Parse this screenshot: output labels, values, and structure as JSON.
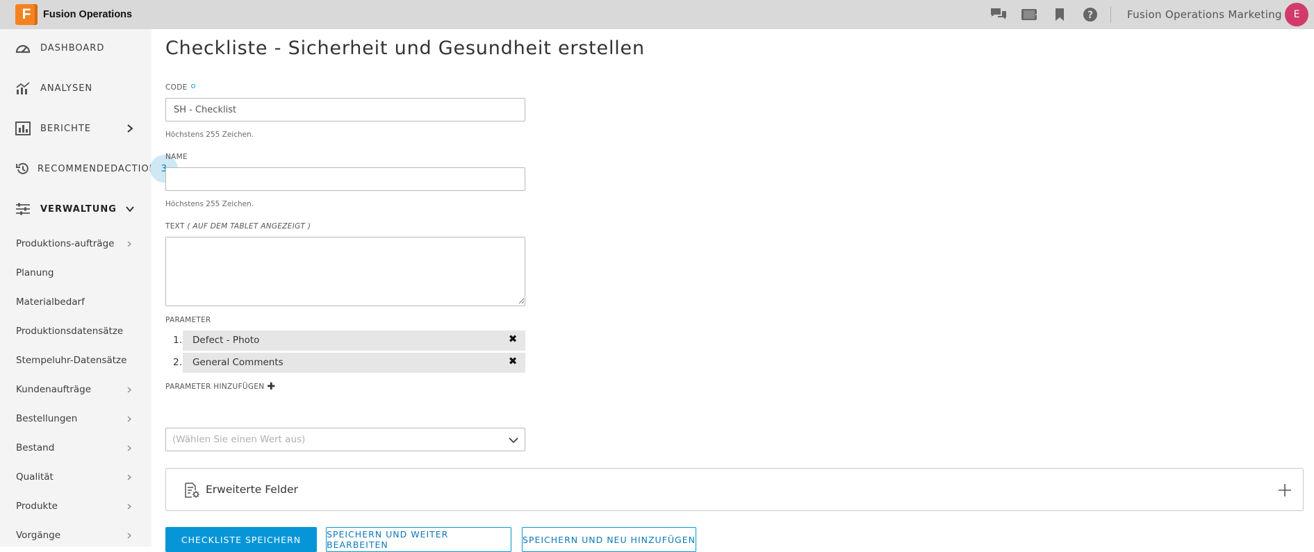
{
  "brand": {
    "logo_letter": "F",
    "name": "Fusion Operations",
    "accent": "#f58220"
  },
  "topbar": {
    "icons": [
      "chat-icon",
      "tablet-icon",
      "bookmark-icon",
      "help-icon"
    ],
    "org_name": "Fusion Operations Marketing",
    "avatar_letter": "E",
    "avatar_color": "#d13b6a"
  },
  "sidebar": {
    "main_items": [
      {
        "label": "DASHBOARD",
        "icon": "gauge-icon"
      },
      {
        "label": "ANALYSEN",
        "icon": "analytics-icon"
      },
      {
        "label": "BERICHTE",
        "icon": "report-icon",
        "chevron": "right"
      },
      {
        "label": "RECOMMENDEDACTIONS",
        "icon": "history-icon",
        "badge": "3"
      },
      {
        "label": "VERWALTUNG",
        "icon": "sliders-icon",
        "chevron": "down"
      }
    ],
    "sub_items": [
      {
        "label": "Produktions-aufträge",
        "has_children": true
      },
      {
        "label": "Planung",
        "has_children": false
      },
      {
        "label": "Materialbedarf",
        "has_children": false
      },
      {
        "label": "Produktionsdatensätze",
        "has_children": false
      },
      {
        "label": "Stempeluhr-Datensätze",
        "has_children": false
      },
      {
        "label": "Kundenaufträge",
        "has_children": true
      },
      {
        "label": "Bestellungen",
        "has_children": true
      },
      {
        "label": "Bestand",
        "has_children": true
      },
      {
        "label": "Qualität",
        "has_children": true
      },
      {
        "label": "Produkte",
        "has_children": true
      },
      {
        "label": "Vorgänge",
        "has_children": true
      }
    ]
  },
  "form": {
    "title": "Checkliste - Sicherheit und Gesundheit erstellen",
    "code": {
      "label": "CODE",
      "value": "SH - Checklist",
      "hint": "Höchstens 255 Zeichen."
    },
    "name": {
      "label": "NAME",
      "value": "",
      "hint": "Höchstens 255 Zeichen."
    },
    "text": {
      "label": "TEXT",
      "label_suffix": "( AUF DEM TABLET ANGEZEIGT )",
      "value": ""
    },
    "parameter": {
      "label": "PARAMETER",
      "items": [
        {
          "number": "1.",
          "label": "Defect - Photo"
        },
        {
          "number": "2.",
          "label": "General Comments"
        }
      ],
      "remove_glyph": "✖"
    },
    "add_parameter": {
      "label": "PARAMETER HINZUFÜGEN",
      "placeholder": "(Wählen Sie einen Wert aus)"
    },
    "extended_fields": {
      "label": "Erweiterte Felder"
    }
  },
  "buttons": {
    "save": "CHECKLISTE SPEICHERN",
    "save_continue": "SPEICHERN UND WEITER BEARBEITEN",
    "save_new": "SPEICHERN UND NEU HINZUFÜGEN",
    "primary_color": "#0696d7"
  }
}
